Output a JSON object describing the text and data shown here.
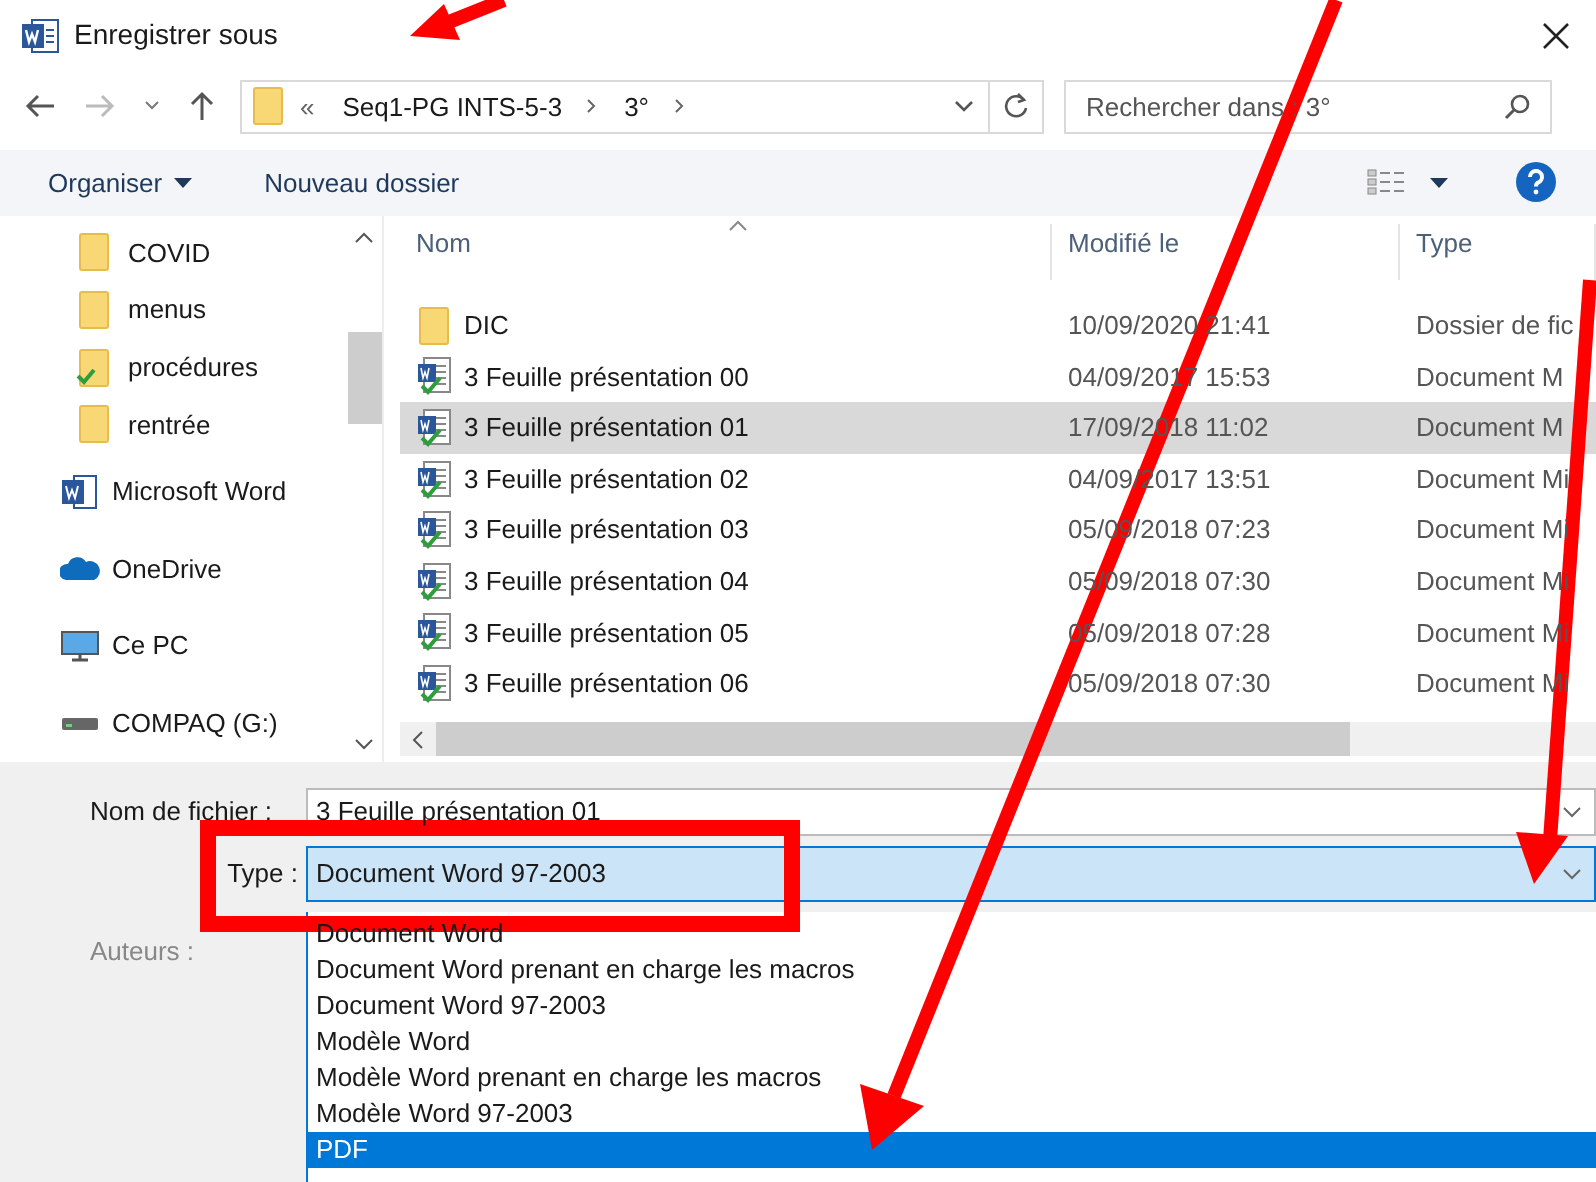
{
  "window": {
    "title": "Enregistrer sous"
  },
  "address": {
    "crumbs": [
      "Seq1-PG INTS-5-3",
      "3°"
    ],
    "overflow": "«"
  },
  "search": {
    "placeholder": "Rechercher dans : 3°"
  },
  "toolbar": {
    "organize": "Organiser",
    "new_folder": "Nouveau dossier"
  },
  "sidebar": {
    "items": [
      {
        "label": "COVID",
        "kind": "folder"
      },
      {
        "label": "menus",
        "kind": "folder"
      },
      {
        "label": "procédures",
        "kind": "synced-folder"
      },
      {
        "label": "rentrée",
        "kind": "folder"
      },
      {
        "label": "Microsoft Word",
        "kind": "word"
      },
      {
        "label": "OneDrive",
        "kind": "cloud"
      },
      {
        "label": "Ce PC",
        "kind": "pc"
      },
      {
        "label": "COMPAQ (G:)",
        "kind": "drive"
      }
    ]
  },
  "table": {
    "columns": [
      "Nom",
      "Modifié le",
      "Type"
    ],
    "rows": [
      {
        "name": "DIC",
        "modified": "10/09/2020 21:41",
        "type": "Dossier de fic",
        "kind": "folder",
        "selected": false
      },
      {
        "name": "3 Feuille présentation 00",
        "modified": "04/09/2017 15:53",
        "type": "Document M",
        "kind": "doc",
        "selected": false
      },
      {
        "name": "3 Feuille présentation 01",
        "modified": "17/09/2018 11:02",
        "type": "Document M",
        "kind": "doc",
        "selected": true
      },
      {
        "name": "3 Feuille présentation 02",
        "modified": "04/09/2017 13:51",
        "type": "Document Mi",
        "kind": "doc",
        "selected": false
      },
      {
        "name": "3 Feuille présentation 03",
        "modified": "05/09/2018 07:23",
        "type": "Document Mi",
        "kind": "doc",
        "selected": false
      },
      {
        "name": "3 Feuille présentation 04",
        "modified": "05/09/2018 07:30",
        "type": "Document Mi",
        "kind": "doc",
        "selected": false
      },
      {
        "name": "3 Feuille présentation 05",
        "modified": "05/09/2018 07:28",
        "type": "Document Mi",
        "kind": "doc",
        "selected": false
      },
      {
        "name": "3 Feuille présentation 06",
        "modified": "05/09/2018 07:30",
        "type": "Document Mi",
        "kind": "doc",
        "selected": false
      }
    ]
  },
  "form": {
    "filename_label": "Nom de fichier :",
    "filename": "3 Feuille présentation 01",
    "type_label": "Type :",
    "type_value": "Document Word 97-2003",
    "authors_label": "Auteurs :",
    "type_options": [
      {
        "label": "Document Word",
        "selected": false
      },
      {
        "label": "Document Word prenant en charge les macros",
        "selected": false
      },
      {
        "label": "Document Word 97-2003",
        "selected": false
      },
      {
        "label": "Modèle Word",
        "selected": false
      },
      {
        "label": "Modèle Word prenant en charge les macros",
        "selected": false
      },
      {
        "label": "Modèle Word 97-2003",
        "selected": false
      },
      {
        "label": "PDF",
        "selected": true
      }
    ]
  }
}
